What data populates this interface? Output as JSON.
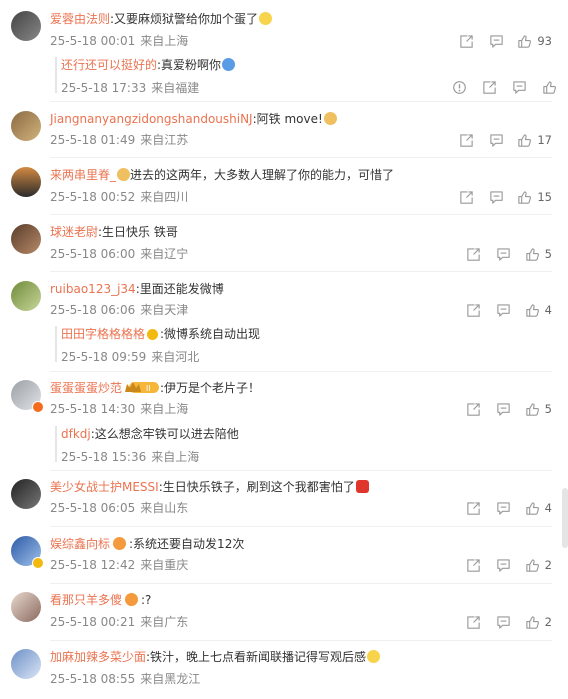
{
  "comments": [
    {
      "user": "爱蓉由法则",
      "text": ":又要麻烦狱警给你加个蛋了",
      "date": "25-5-18 00:01",
      "loc": "来自上海",
      "likes": "93"
    },
    {
      "user": "还行还可以挺好的",
      "text": ":真爱粉啊你",
      "date": "25-5-18 17:33",
      "loc": "来自福建"
    },
    {
      "user": "JiangnanyangzidongshandoushiNJ",
      "text": ":阿铁 move!",
      "date": "25-5-18 01:49",
      "loc": "来自江苏",
      "likes": "17"
    },
    {
      "user": "来两串里脊_",
      "text": "进去的这两年，大多数人理解了你的能力，可惜了",
      "date": "25-5-18 00:52",
      "loc": "来自四川",
      "likes": "15"
    },
    {
      "user": "球迷老尉",
      "text": ":生日快乐 铁哥",
      "date": "25-5-18 06:00",
      "loc": "来自辽宁",
      "likes": "5"
    },
    {
      "user": "ruibao123_j34",
      "text": ":里面还能发微博",
      "date": "25-5-18 06:06",
      "loc": "来自天津",
      "likes": "4"
    },
    {
      "user": "田田字格格格格",
      "text": ":微博系统自动出现",
      "date": "25-5-18 09:59",
      "loc": "来自河北"
    },
    {
      "user": "蛋蛋蛋蛋炒范",
      "text": ":伊万是个老片子！",
      "date": "25-5-18 14:30",
      "loc": "来自上海",
      "likes": "5"
    },
    {
      "user": "dfkdj",
      "text": ":这么想念牢铁可以进去陪他",
      "date": "25-5-18 15:36",
      "loc": "来自上海"
    },
    {
      "user": "美少女战士护MESSI",
      "text": ":生日快乐铁子，刷到这个我都害怕了",
      "date": "25-5-18 06:05",
      "loc": "来自山东",
      "likes": "4"
    },
    {
      "user": "娱综鑫向标",
      "text": ":系统还要自动发12次",
      "date": "25-5-18 12:42",
      "loc": "来自重庆",
      "likes": "2"
    },
    {
      "user": "看那只羊多傻",
      "text": ":?",
      "date": "25-5-18 00:21",
      "loc": "来自广东",
      "likes": "2"
    },
    {
      "user": "加麻加辣多菜少面",
      "text": ":铁汁，晚上七点看新闻联播记得写观后感",
      "date": "25-5-18 08:55",
      "loc": "来自黑龙江"
    }
  ],
  "colors": {
    "username": "#eb7350",
    "meta": "#888888",
    "text": "#333333"
  }
}
